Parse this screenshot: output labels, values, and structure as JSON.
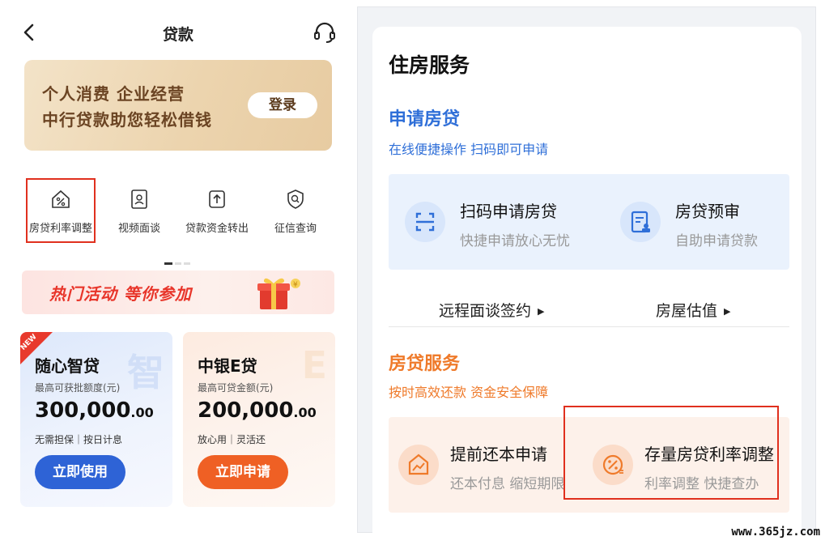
{
  "left": {
    "header": {
      "title": "贷款",
      "back_icon": "chevron-left-icon",
      "service_icon": "headset-icon"
    },
    "banner": {
      "line1": "个人消费 企业经营",
      "line2": "中行贷款助您轻松借钱",
      "login_label": "登录"
    },
    "functions": [
      {
        "label": "房贷利率调整",
        "icon": "house-percent-icon"
      },
      {
        "label": "视频面谈",
        "icon": "video-person-icon"
      },
      {
        "label": "贷款资金转出",
        "icon": "transfer-out-icon"
      },
      {
        "label": "征信查询",
        "icon": "shield-search-icon"
      }
    ],
    "promo": {
      "text": "热门活动 等你参加",
      "icon": "gift-box-icon"
    },
    "cards": [
      {
        "badge": "NEW",
        "title": "随心智贷",
        "watermark": "智",
        "subtitle": "最高可获批额度(元)",
        "amount": "300,000",
        "decimals": ".00",
        "tags": "无需担保｜按日计息",
        "button": "立即使用",
        "accent": "#2e63d6"
      },
      {
        "badge": "",
        "title": "中银E贷",
        "watermark": "E",
        "subtitle": "最高可贷金额(元)",
        "amount": "200,000",
        "decimals": ".00",
        "tags": "放心用｜灵活还",
        "button": "立即申请",
        "accent": "#ef6024"
      }
    ]
  },
  "right": {
    "heading": "住房服务",
    "apply": {
      "title": "申请房贷",
      "subtitle": "在线便捷操作 扫码即可申请",
      "tiles": [
        {
          "title": "扫码申请房贷",
          "subtitle": "快捷申请放心无忧",
          "icon": "scan-icon"
        },
        {
          "title": "房贷预审",
          "subtitle": "自助申请贷款",
          "icon": "document-person-icon"
        }
      ],
      "links": [
        {
          "label": "远程面谈签约"
        },
        {
          "label": "房屋估值"
        }
      ]
    },
    "service": {
      "title": "房贷服务",
      "subtitle": "按时高效还款 资金安全保障",
      "tiles": [
        {
          "title": "提前还本申请",
          "subtitle": "还本付息 缩短期限",
          "icon": "chart-house-icon"
        },
        {
          "title": "存量房贷利率调整",
          "subtitle": "利率调整 快捷查办",
          "icon": "percent-circle-icon"
        }
      ]
    }
  },
  "watermark": "www.365jz.com",
  "colors": {
    "blue": "#2f6fd8",
    "orange": "#ef7a2a",
    "highlight": "#e0301e"
  }
}
